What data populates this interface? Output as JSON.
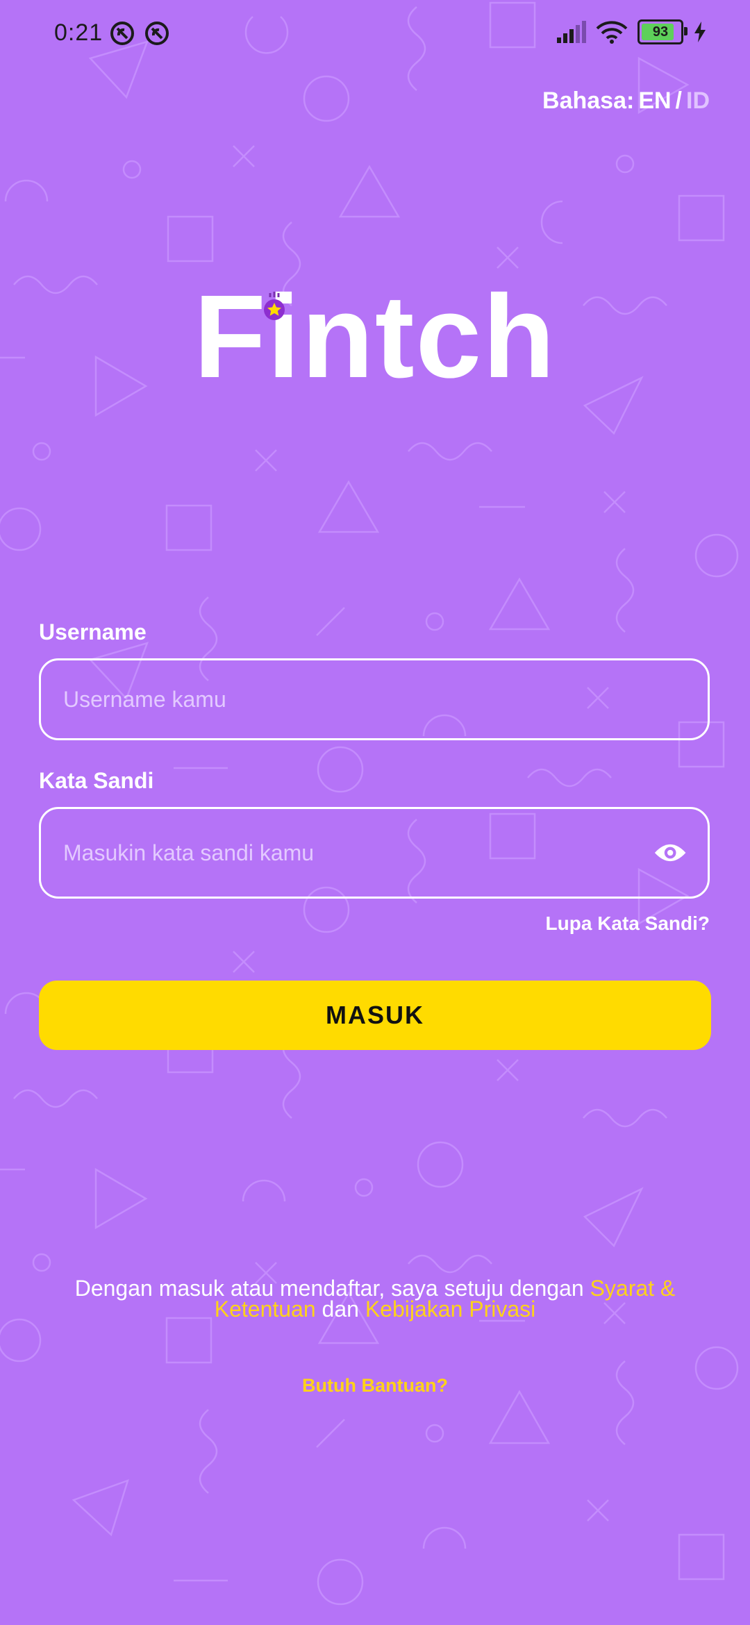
{
  "status_bar": {
    "time": "0:21",
    "battery": "93",
    "icons": [
      "vpn-icon",
      "vpn-icon",
      "signal-icon",
      "wifi-icon",
      "battery-icon",
      "charging-icon"
    ]
  },
  "language": {
    "label": "Bahasa:",
    "en": "EN",
    "separator": "/",
    "id": "ID"
  },
  "logo": {
    "text": "Fintch"
  },
  "form": {
    "username_label": "Username",
    "username_placeholder": "Username kamu",
    "password_label": "Kata Sandi",
    "password_placeholder": "Masukin kata sandi kamu",
    "forgot_password": "Lupa Kata Sandi?",
    "login_button": "MASUK"
  },
  "terms": {
    "prefix": "Dengan masuk atau mendaftar, saya setuju dengan ",
    "terms_link": "Syarat & Ketentuan",
    "middle": " dan ",
    "privacy_link": "Kebijakan Privasi"
  },
  "help": "Butuh Bantuan?",
  "colors": {
    "background": "#b573f7",
    "accent": "#ffdb00",
    "link": "#ffd21a"
  }
}
